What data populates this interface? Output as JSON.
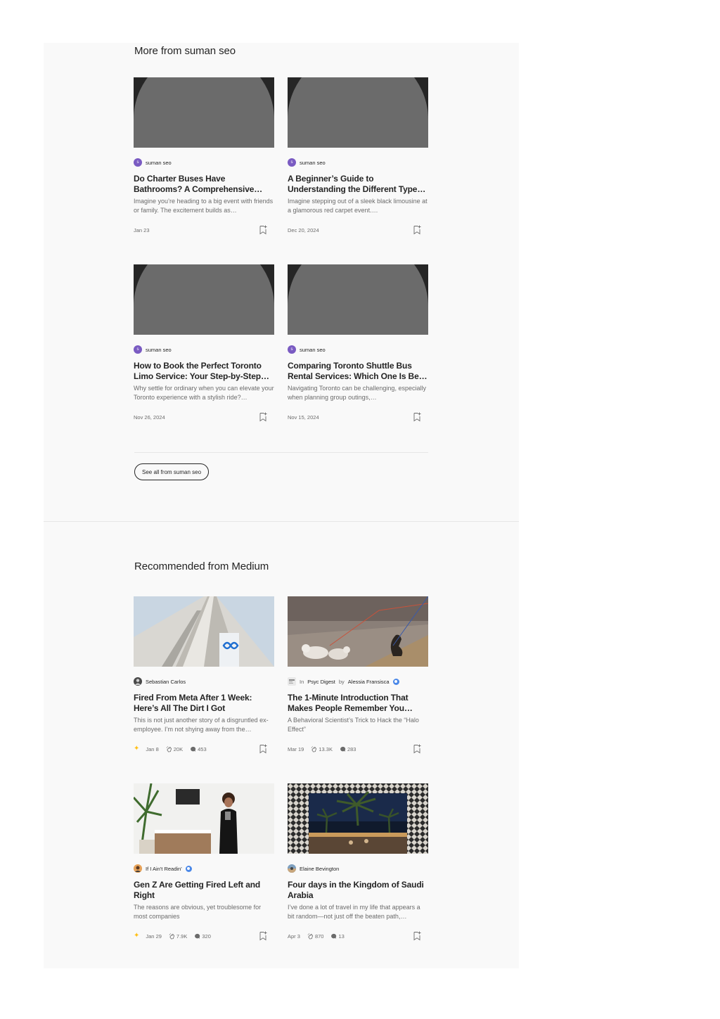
{
  "more_section": {
    "heading": "More from suman seo",
    "see_all_label": "See all from suman seo",
    "cards": [
      {
        "author": "suman seo",
        "avatar_letter": "s",
        "title": "Do Charter Buses Have Bathrooms? A Comprehensive…",
        "subtitle": "Imagine you’re heading to a big event with friends or family. The excitement builds as…",
        "date": "Jan 23"
      },
      {
        "author": "suman seo",
        "avatar_letter": "s",
        "title": "A Beginner’s Guide to Understanding the Different Type…",
        "subtitle": "Imagine stepping out of a sleek black limousine at a glamorous red carpet event.…",
        "date": "Dec 20, 2024"
      },
      {
        "author": "suman seo",
        "avatar_letter": "s",
        "title": "How to Book the Perfect Toronto Limo Service: Your Step-by-Step…",
        "subtitle": "Why settle for ordinary when you can elevate your Toronto experience with a stylish ride?…",
        "date": "Nov 26, 2024"
      },
      {
        "author": "suman seo",
        "avatar_letter": "s",
        "title": "Comparing Toronto Shuttle Bus Rental Services: Which One Is Be…",
        "subtitle": "Navigating Toronto can be challenging, especially when planning group outings,…",
        "date": "Nov 15, 2024"
      }
    ]
  },
  "recommended_section": {
    "heading": "Recommended from Medium",
    "cards": [
      {
        "author": "Sebastian Carlos",
        "in_label": "",
        "publication": "",
        "by_label": "",
        "title": "Fired From Meta After 1 Week: Here’s All The Dirt I Got",
        "subtitle": "This is not just another story of a disgruntled ex-employee. I’m not shying away from the…",
        "date": "Jan 8",
        "claps": "20K",
        "comments": "453",
        "member_only": true,
        "image": "meta-building"
      },
      {
        "author": "Alessia Fransisca",
        "in_label": "In",
        "publication": "Psyc Digest",
        "by_label": "by",
        "title": "The 1-Minute Introduction That Makes People Remember You…",
        "subtitle": "A Behavioral Scientist’s Trick to Hack the “Halo Effect”",
        "date": "Mar 19",
        "claps": "13.3K",
        "comments": "283",
        "member_only": false,
        "image": "dogs-cat"
      },
      {
        "author": "If I Ain't Readin'",
        "in_label": "",
        "publication": "",
        "by_label": "",
        "title": "Gen Z Are Getting Fired Left and Right",
        "subtitle": "The reasons are obvious, yet troublesome for most companies",
        "date": "Jan 29",
        "claps": "7.9K",
        "comments": "320",
        "member_only": true,
        "image": "woman-office"
      },
      {
        "author": "Elaine Bevington",
        "in_label": "",
        "publication": "",
        "by_label": "",
        "title": "Four days in the Kingdom of Saudi Arabia",
        "subtitle": "I’ve done a lot of travel in my life that appears a bit random—not just off the beaten path,…",
        "date": "Apr 3",
        "claps": "870",
        "comments": "13",
        "member_only": false,
        "image": "saudi-garden"
      }
    ]
  },
  "icons": {
    "bookmark": "bookmark-add-icon",
    "clap": "clap-icon",
    "comment": "comment-bubble-icon",
    "member": "star-icon",
    "verified": "verified-badge-icon"
  },
  "colors": {
    "page_bg": "#ffffff",
    "panel_bg": "#f9f9f9",
    "text_primary": "#242424",
    "text_muted": "#6b6b6b",
    "member_star": "#ffc017",
    "avatar_purple": "#7a5bc2",
    "verified_blue": "#4a88e8"
  },
  "symbols": {
    "member_star": "✦"
  }
}
